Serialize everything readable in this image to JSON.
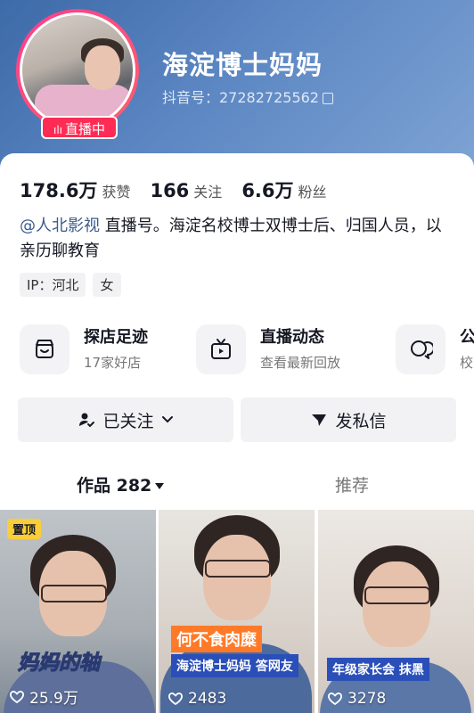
{
  "header": {
    "nickname": "海淀博士妈妈",
    "douyin_id": "抖音号：27282725562",
    "live_badge": "直播中",
    "brand_color": "#fe2c55"
  },
  "stats": {
    "likes_num": "178.6万",
    "likes_label": "获赞",
    "following_num": "166",
    "following_label": "关注",
    "fans_num": "6.6万",
    "fans_label": "粉丝"
  },
  "bio": {
    "mention": "@人北影视",
    "text": " 直播号。海淀名校博士双博士后、归国人员，以亲历聊教育"
  },
  "tags": [
    "IP：河北",
    "女"
  ],
  "entries": [
    {
      "title": "探店足迹",
      "subtitle": "17家好店",
      "icon": "store-icon"
    },
    {
      "title": "直播动态",
      "subtitle": "查看最新回放",
      "icon": "tv-icon"
    },
    {
      "title": "公",
      "subtitle": "校",
      "icon": "chat-bubbles-icon"
    }
  ],
  "buttons": {
    "follow": "已关注",
    "message": "发私信"
  },
  "tabs": {
    "works": "作品 282",
    "recommend": "推荐"
  },
  "videos": [
    {
      "pinned": "置顶",
      "caption": "妈妈的轴",
      "likes": "25.9万"
    },
    {
      "caption_top": "何不食肉糜",
      "caption_bottom": "海淀博士妈妈 答网友",
      "likes": "2483"
    },
    {
      "caption": "年级家长会  抹黑",
      "likes": "3278"
    }
  ]
}
